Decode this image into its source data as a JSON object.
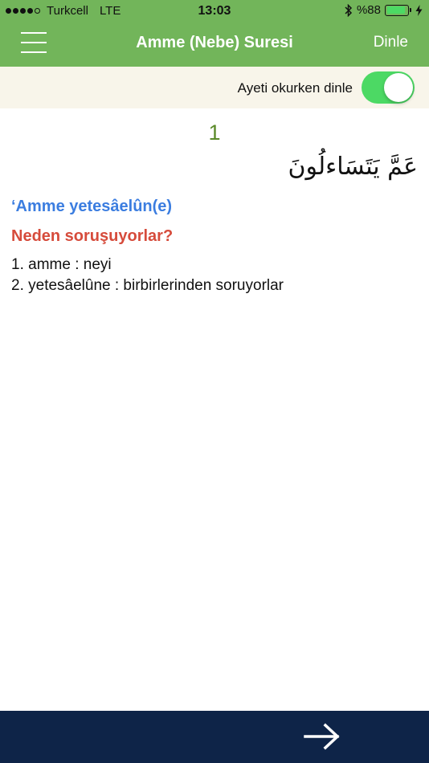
{
  "status_bar": {
    "carrier": "Turkcell",
    "network": "LTE",
    "time": "13:03",
    "bluetooth_icon": "bluetooth-icon",
    "battery_text": "%88",
    "battery_level": 0.88,
    "charging_icon": "lightning-icon"
  },
  "header": {
    "menu_icon": "hamburger-menu-icon",
    "title": "Amme (Nebe) Suresi",
    "listen_label": "Dinle"
  },
  "settings": {
    "listen_while_reading_label": "Ayeti okurken dinle",
    "listen_while_reading_on": true
  },
  "ayah": {
    "number": "1",
    "arabic": "عَمَّ يَتَسَاءلُونَ",
    "transliteration": "‘Amme yetesâelûn(e)",
    "translation": "Neden soruşuyorlar?",
    "words": [
      "1. amme : neyi",
      "2. yetesâelûne : birbirlerinden soruyorlar"
    ]
  },
  "footer": {
    "next_icon": "arrow-right-icon"
  },
  "colors": {
    "header_green": "#72b55a",
    "toggle_bar_bg": "#f8f5ea",
    "toggle_on": "#4cd964",
    "ayah_number": "#5b8a2a",
    "transliteration": "#3b7de0",
    "translation": "#d64b3b",
    "footer_navy": "#0e2448"
  }
}
